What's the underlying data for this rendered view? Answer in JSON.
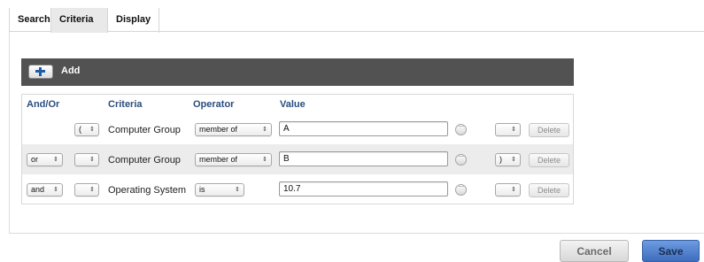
{
  "tabs": [
    {
      "label": "Search",
      "active": false
    },
    {
      "label": "Criteria",
      "active": true
    },
    {
      "label": "Display",
      "active": false
    }
  ],
  "add_bar": {
    "add_label": "Add",
    "add_icon": "plus-icon"
  },
  "table": {
    "headers": {
      "and_or": "And/Or",
      "criteria": "Criteria",
      "operator": "Operator",
      "value": "Value"
    },
    "rows": [
      {
        "and_or": "",
        "open_paren": "(",
        "criteria": "Computer Group",
        "operator": "member of",
        "value": "A",
        "close_paren": "",
        "delete_label": "Delete"
      },
      {
        "and_or": "or",
        "open_paren": "",
        "criteria": "Computer Group",
        "operator": "member of",
        "value": "B",
        "close_paren": ")",
        "delete_label": "Delete"
      },
      {
        "and_or": "and",
        "open_paren": "",
        "criteria": "Operating System",
        "operator": "is",
        "value": "10.7",
        "close_paren": "",
        "delete_label": "Delete"
      }
    ],
    "select_arrow": "⇕",
    "ellipsis_icon": "···"
  },
  "footer": {
    "cancel_label": "Cancel",
    "save_label": "Save"
  },
  "colors": {
    "accent": "#3e6dbd",
    "header_text": "#2a4d7e",
    "add_bar": "#525252"
  }
}
